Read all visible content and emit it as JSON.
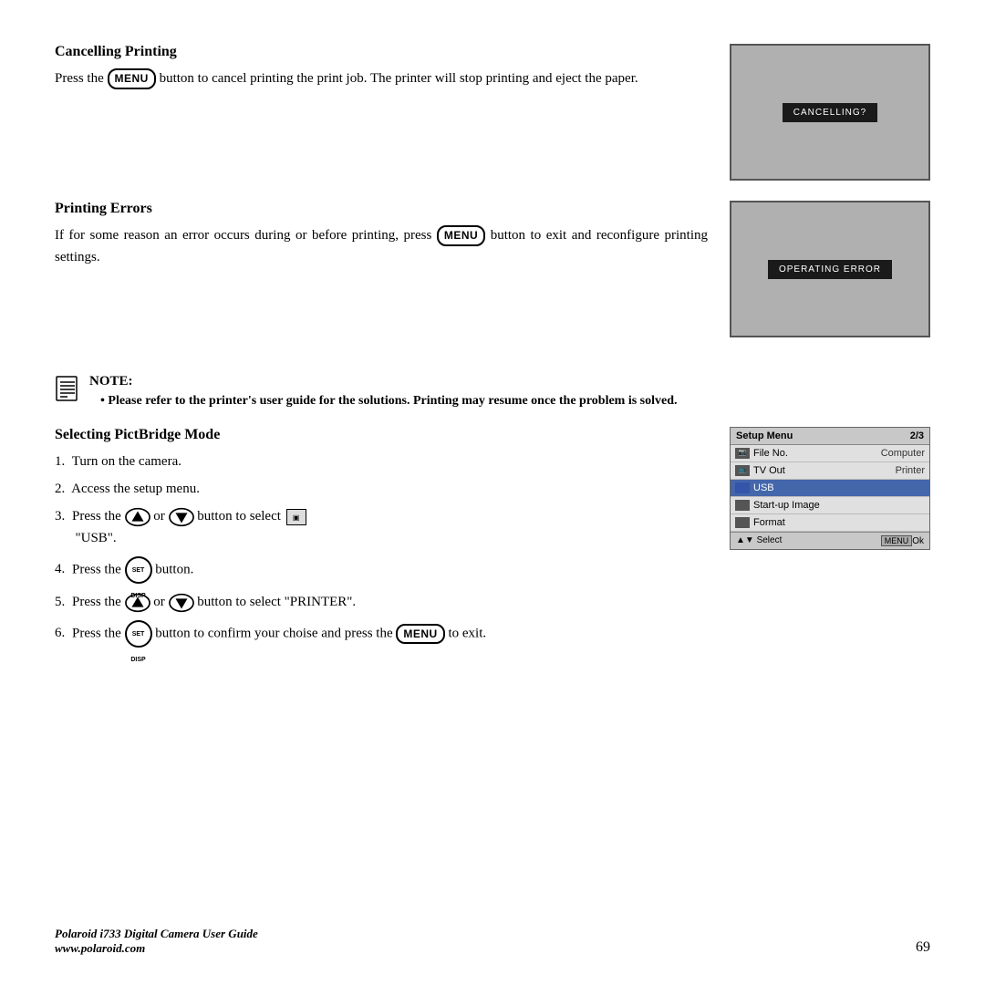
{
  "page": {
    "sections": [
      {
        "id": "cancelling-printing",
        "title": "Cancelling Printing",
        "body": "Press the  button to cancel printing the print job. The printer will stop printing and eject the paper.",
        "screen": {
          "label": "CANCELLING?"
        }
      },
      {
        "id": "printing-errors",
        "title": "Printing Errors",
        "body_part1": "If for some reason an error occurs during or before printing, press ",
        "body_part2": " button to exit and reconfigure printing settings.",
        "screen": {
          "label": "OPERATING ERROR"
        }
      }
    ],
    "note": {
      "title": "NOTE:",
      "bullets": [
        "Please refer to the printer's user guide for the solutions. Printing may resume once the problem is solved."
      ]
    },
    "pictbridge": {
      "title": "Selecting PictBridge Mode",
      "steps": [
        {
          "num": "1.",
          "text": "Turn on the camera."
        },
        {
          "num": "2.",
          "text": "Access the setup menu."
        },
        {
          "num": "3.",
          "text_before": "Press the ",
          "or": "or",
          "text_after": " button to select ",
          "usb_label": "\"USB\"."
        },
        {
          "num": "4.",
          "text_before": "Press the ",
          "text_after": " button."
        },
        {
          "num": "5.",
          "text_before": "Press the ",
          "or": "or",
          "text_after": " button to select \"PRINTER\"."
        },
        {
          "num": "6.",
          "text_before": "Press the ",
          "text_mid": " button to confirm your choise and press the ",
          "text_after": " to exit."
        }
      ],
      "setup_menu": {
        "title": "Setup Menu",
        "page": "2/3",
        "rows": [
          {
            "icon": "img",
            "label": "File No.",
            "value": "Computer"
          },
          {
            "icon": "vid",
            "label": "TV Out",
            "value": "Printer"
          },
          {
            "icon": "usb",
            "label": "USB",
            "value": "",
            "highlighted": true
          },
          {
            "icon": "cam",
            "label": "Start-up  Image",
            "value": ""
          },
          {
            "icon": "fmt",
            "label": "Format",
            "value": ""
          }
        ],
        "footer": {
          "select_label": "Select",
          "ok_label": "Ok"
        }
      }
    },
    "footer": {
      "brand_line1": "Polaroid i733 Digital Camera User Guide",
      "brand_line2": "www.polaroid.com",
      "page_number": "69"
    }
  }
}
